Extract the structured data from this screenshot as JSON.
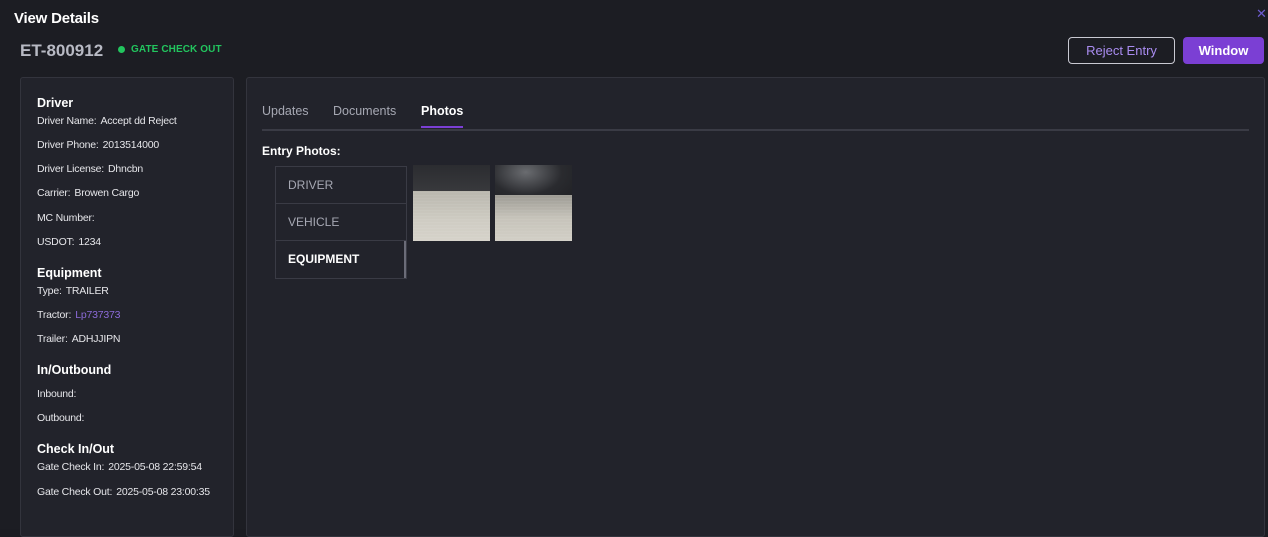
{
  "modal": {
    "title": "View Details",
    "close_icon": "close-icon",
    "entry_id": "ET-800912",
    "status": {
      "label": "GATE CHECK OUT",
      "color": "#22c55e"
    },
    "actions": {
      "reject_label": "Reject Entry",
      "window_label": "Window"
    }
  },
  "details": {
    "driver": {
      "title": "Driver",
      "name_label": "Driver Name:",
      "name": "Accept dd Reject",
      "phone_label": "Driver Phone:",
      "phone": "2013514000",
      "license_label": "Driver License:",
      "license": "Dhncbn",
      "carrier_label": "Carrier:",
      "carrier": "Browen Cargo",
      "mc_label": "MC Number:",
      "mc": "",
      "usdot_label": "USDOT:",
      "usdot": "1234"
    },
    "equipment": {
      "title": "Equipment",
      "type_label": "Type:",
      "type": "TRAILER",
      "tractor_label": "Tractor:",
      "tractor": "Lp737373",
      "trailer_label": "Trailer:",
      "trailer": "ADHJJIPN"
    },
    "inout": {
      "title": "In/Outbound",
      "inbound_label": "Inbound:",
      "inbound": "",
      "outbound_label": "Outbound:",
      "outbound": ""
    },
    "check": {
      "title": "Check In/Out",
      "in_label": "Gate Check In:",
      "in": "2025-05-08 22:59:54",
      "out_label": "Gate Check Out:",
      "out": "2025-05-08 23:00:35"
    }
  },
  "tabs": {
    "items": [
      "Updates",
      "Documents",
      "Photos"
    ],
    "active": "Photos"
  },
  "photos": {
    "section_label": "Entry Photos:",
    "categories": [
      "DRIVER",
      "VEHICLE",
      "EQUIPMENT"
    ],
    "active_category": "EQUIPMENT"
  },
  "colors": {
    "accent": "#7b3fd4",
    "link": "#8b6ad8",
    "background": "#1c1d23",
    "panel": "#22232b"
  }
}
